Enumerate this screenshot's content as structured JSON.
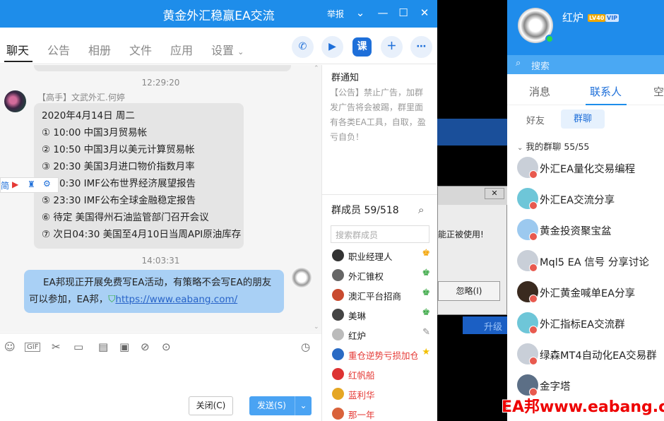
{
  "chat_window": {
    "title": "黄金外汇稳赢EA交流",
    "report_label": "举报",
    "tabs": [
      "聊天",
      "公告",
      "相册",
      "文件",
      "应用",
      "设置"
    ],
    "toolbar_icons": [
      "phone-icon",
      "video-icon",
      "lesson-icon",
      "add-app-icon",
      "more-icon"
    ],
    "lesson_icon_label": "课"
  },
  "messages": {
    "time1": "12:29:20",
    "sender": "【高手】文武外汇.何婷",
    "lines": [
      "2020年4月14日 周二",
      "① 10:00 中国3月贸易帐",
      "② 10:50 中国3月以美元计算贸易帐",
      "③ 20:30 美国3月进口物价指数月率",
      "④ 20:30 IMF公布世界经济展望报告",
      "⑤ 23:30 IMF公布全球金融稳定报告",
      "⑥ 待定 美国得州石油监管部门召开会议",
      "⑦ 次日04:30 美国至4月10日当周API原油库存"
    ],
    "strip_text": "简",
    "time2": "14:03:31",
    "own_text": "EA邦现正开展免费写EA活动，有策略不会写EA的朋友可以参加，EA邦，",
    "own_link": "https://www.eabang.com/"
  },
  "input": {
    "close_label": "关闭(C)",
    "send_label": "发送(S)"
  },
  "group_notice": {
    "title": "群通知",
    "body": "【公告】禁止广告，加群发广告将会被踢，群里面有各类EA工具，自取，盈亏自负！"
  },
  "members": {
    "title": "群成员 59/518",
    "search_placeholder": "搜索群成员",
    "list": [
      {
        "name": "职业经理人",
        "color": "#222",
        "badge": "admin-icon"
      },
      {
        "name": "外汇锥权",
        "color": "#222",
        "badge": "admin-icon"
      },
      {
        "name": "澳汇平台招商",
        "color": "#222",
        "badge": "admin-icon"
      },
      {
        "name": "美琳",
        "color": "#222",
        "badge": "admin-icon"
      },
      {
        "name": "红炉",
        "color": "#222",
        "badge": "edit-icon"
      },
      {
        "name": "重仓逆势亏损加仓",
        "color": "#e53935",
        "badge": "star-icon"
      },
      {
        "name": "红帆船",
        "color": "#e53935",
        "badge": ""
      },
      {
        "name": "蓝利华",
        "color": "#e53935",
        "badge": ""
      },
      {
        "name": "那一年",
        "color": "#e53935",
        "badge": ""
      }
    ]
  },
  "background": {
    "dialog_msg": "能正被使用!",
    "dialog_button": "忽略(I)",
    "upgrade": "升级"
  },
  "contacts": {
    "user_name": "红炉",
    "level_badge": "LV40",
    "vip_badge": "VIP",
    "search_label": "搜索",
    "tabs": [
      "消息",
      "联系人",
      "空"
    ],
    "subtabs": [
      "好友",
      "群聊"
    ],
    "group_header": "我的群聊  55/55",
    "groups": [
      {
        "name": "外汇EA量化交易编程",
        "color": "#c9cfd8"
      },
      {
        "name": "外汇EA交流分享",
        "color": "#6ec6d8"
      },
      {
        "name": "黄金投资聚宝盆",
        "color": "#9cc9ef"
      },
      {
        "name": "Mql5 EA 信号 分享讨论",
        "color": "#c9cfd8"
      },
      {
        "name": "外汇黄金喊单EA分享",
        "color": "#3a2a1f"
      },
      {
        "name": "外汇指标EA交流群",
        "color": "#6ec6d8"
      },
      {
        "name": "绿森MT4自动化EA交易群",
        "color": "#c9cfd8"
      },
      {
        "name": "金字塔",
        "color": "#5c6f86"
      }
    ]
  },
  "watermark": "EA邦www.eabang.com",
  "colors": {
    "brand_blue": "#1e8dea",
    "bubble_own": "#a9d0f5",
    "bubble_other": "#e5e5e5"
  }
}
